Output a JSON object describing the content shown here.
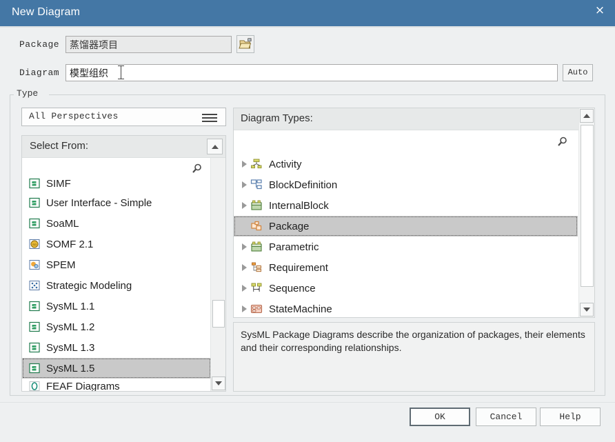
{
  "window": {
    "title": "New Diagram",
    "close_label": "×"
  },
  "form": {
    "package_label": "Package",
    "package_value": "蒸馏器项目",
    "browse_icon": "folder-icon",
    "diagram_label": "Diagram",
    "diagram_value": "模型组织",
    "auto_label": "Auto"
  },
  "type_group": {
    "legend": "Type",
    "perspective_value": "All Perspectives",
    "perspective_menu_icon": "hamburger-icon"
  },
  "select_from": {
    "header": "Select From:",
    "search_icon": "search-icon",
    "collapse_icon": "triangle-up-icon",
    "scroll_up_icon": "triangle-up-icon",
    "scroll_down_icon": "triangle-down-icon",
    "items": [
      {
        "label": "SIMF",
        "icon": "profile-green-icon",
        "selected": false,
        "clipped": true
      },
      {
        "label": "User Interface - Simple",
        "icon": "profile-green-icon",
        "selected": false
      },
      {
        "label": "SoaML",
        "icon": "profile-green-icon",
        "selected": false
      },
      {
        "label": "SOMF 2.1",
        "icon": "somf-yellow-icon",
        "selected": false
      },
      {
        "label": "SPEM",
        "icon": "spem-orange-icon",
        "selected": false
      },
      {
        "label": "Strategic Modeling",
        "icon": "strategic-blue-icon",
        "selected": false
      },
      {
        "label": "SysML 1.1",
        "icon": "profile-green-icon",
        "selected": false
      },
      {
        "label": "SysML 1.2",
        "icon": "profile-green-icon",
        "selected": false
      },
      {
        "label": "SysML 1.3",
        "icon": "profile-green-icon",
        "selected": false
      },
      {
        "label": "SysML 1.5",
        "icon": "profile-green-icon",
        "selected": true
      },
      {
        "label": "FEAF Diagrams",
        "icon": "feaf-teal-icon",
        "selected": false,
        "clipped": true
      }
    ]
  },
  "diagram_types": {
    "header": "Diagram Types:",
    "search_icon": "search-icon",
    "scroll_up_icon": "triangle-up-icon",
    "scroll_down_icon": "triangle-down-icon",
    "items": [
      {
        "label": "Activity",
        "icon": "activity-icon",
        "expandable": true,
        "selected": false
      },
      {
        "label": "BlockDefinition",
        "icon": "blockdefinition-icon",
        "expandable": true,
        "selected": false
      },
      {
        "label": "InternalBlock",
        "icon": "internalblock-icon",
        "expandable": true,
        "selected": false
      },
      {
        "label": "Package",
        "icon": "package-icon",
        "expandable": false,
        "selected": true
      },
      {
        "label": "Parametric",
        "icon": "parametric-icon",
        "expandable": true,
        "selected": false
      },
      {
        "label": "Requirement",
        "icon": "requirement-icon",
        "expandable": true,
        "selected": false
      },
      {
        "label": "Sequence",
        "icon": "sequence-icon",
        "expandable": true,
        "selected": false
      },
      {
        "label": "StateMachine",
        "icon": "statemachine-icon",
        "expandable": true,
        "selected": false
      }
    ]
  },
  "description": {
    "text": "SysML Package Diagrams describe the organization of packages, their elements and their corresponding relationships."
  },
  "footer": {
    "ok_label": "OK",
    "cancel_label": "Cancel",
    "help_label": "Help"
  },
  "colors": {
    "titlebar": "#4477a5",
    "dialog_bg": "#eef0f1",
    "selection": "#c9c9c9",
    "accent_text": "#ffffff"
  }
}
